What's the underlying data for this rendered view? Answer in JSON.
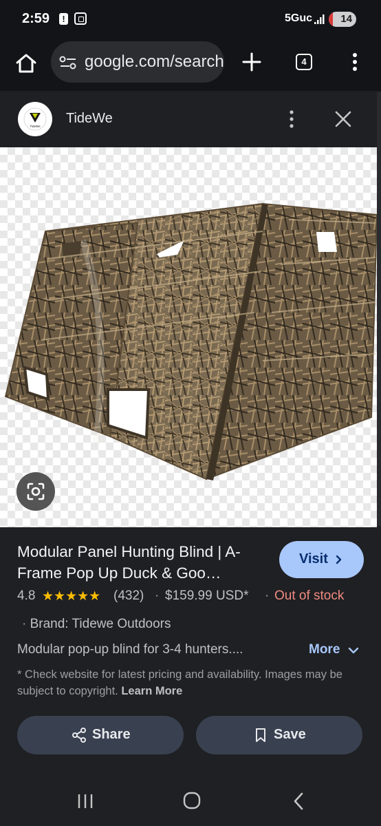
{
  "status_bar": {
    "time": "2:59",
    "network": "5Guc",
    "battery": "14",
    "battery_level_percent": 14,
    "icons": [
      "alert-icon",
      "screenshot-icon",
      "signal-icon",
      "battery-icon"
    ]
  },
  "browser": {
    "url": "google.com/search",
    "tab_count": "4",
    "icons": [
      "home-icon",
      "tune-icon",
      "plus-icon",
      "tabs-icon",
      "more-vert-icon"
    ]
  },
  "sheet": {
    "site_name": "TideWe",
    "logo_text": "TideWe",
    "icons": [
      "more-vert-icon",
      "close-icon"
    ]
  },
  "product": {
    "title": "Modular Panel Hunting Blind | A-Frame Pop Up Duck & Goo…",
    "visit_label": "Visit",
    "rating": "4.8",
    "stars": "★★★★★",
    "reviews": "(432)",
    "price": "$159.99 USD*",
    "stock": "Out of stock",
    "brand": "Brand: Tidewe Outdoors",
    "description": "Modular pop-up blind for 3-4 hunters....",
    "more_label": "More",
    "disclaimer": "* Check website for latest pricing and availability. Images may be subject to copyright.",
    "learn_more": "Learn More"
  },
  "actions": {
    "share_label": "Share",
    "save_label": "Save"
  },
  "colors": {
    "background": "#1f2023",
    "accent": "#a8c7fa",
    "stars": "#fbbc04",
    "out_of_stock": "#f28b82",
    "action_button": "#394150"
  }
}
